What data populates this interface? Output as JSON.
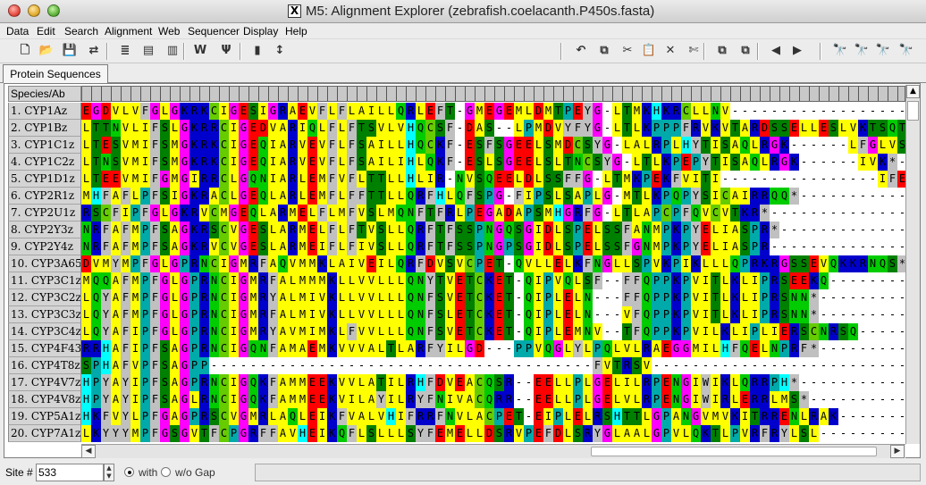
{
  "window": {
    "title": "M5: Alignment Explorer (zebrafish.coelacanth.P450s.fasta)"
  },
  "menu": [
    "Data",
    "Edit",
    "Search",
    "Alignment",
    "Web",
    "Sequencer",
    "Display",
    "Help"
  ],
  "toolbar": {
    "left": [
      {
        "name": "new-file-icon",
        "glyph": "🗋"
      },
      {
        "name": "open-folder-icon",
        "glyph": "📂"
      },
      {
        "name": "save-icon",
        "glyph": "💾"
      },
      {
        "name": "translate-icon",
        "glyph": "⇄"
      },
      {
        "name": "align-clustal-icon",
        "glyph": "≣"
      },
      {
        "name": "align-muscle-icon",
        "glyph": "▤"
      },
      {
        "name": "dna-toggle-icon",
        "glyph": "▥"
      },
      {
        "name": "clustalw-icon",
        "glyph": "W"
      },
      {
        "name": "muscle-arm-icon",
        "glyph": "Ψ"
      },
      {
        "name": "mark-site-icon",
        "glyph": "▮"
      },
      {
        "name": "cursor-icon",
        "glyph": "↕"
      }
    ],
    "right": [
      {
        "name": "undo-icon",
        "glyph": "↶"
      },
      {
        "name": "copy-icon",
        "glyph": "⧉"
      },
      {
        "name": "cut-icon",
        "glyph": "✂"
      },
      {
        "name": "paste-icon",
        "glyph": "📋"
      },
      {
        "name": "delete-icon",
        "glyph": "✕"
      },
      {
        "name": "delete-gap-columns-icon",
        "glyph": "✄"
      },
      {
        "name": "paste-block-icon",
        "glyph": "⧉"
      },
      {
        "name": "paste-block-alt-icon",
        "glyph": "⧉"
      },
      {
        "name": "prev-marked-icon",
        "glyph": "◀"
      },
      {
        "name": "next-marked-icon",
        "glyph": "▶"
      },
      {
        "name": "find-icon",
        "glyph": "🔭"
      },
      {
        "name": "find-previous-icon",
        "glyph": "🔭"
      },
      {
        "name": "find-next-icon",
        "glyph": "🔭"
      },
      {
        "name": "find-motif-icon",
        "glyph": "🔭"
      }
    ]
  },
  "tabs": [
    "Protein Sequences"
  ],
  "grid": {
    "header": "Species/Ab",
    "rows": [
      {
        "name": "1. CYP1Az",
        "seq": "EGDVLVFGLGKRKCIGESIGRAEVFLFLAILLQRLEFT-GMEGEMLDMTPEYG-LTMKHKRCLLNV---------------------TIKRGF----"
      },
      {
        "name": "2. CYP1Bz",
        "seq": "LTTNVLIFSLGKRRCIGEDVARIQLFLFTSVLVHQCSF-DAS--LPMDVYFYG-LTLKPPPFRVKVTARDSSELLESLVKTSQTETGV-"
      },
      {
        "name": "3. CYP1C1z",
        "seq": "LTESVMIFSMGKRKCIGEQIARVEVFLFSAILLHQCKF-ESFSGEELSMDCSYG-LALRPLHYTISAQLRGK------LFGLVSPA---"
      },
      {
        "name": "4. CYP1C2z",
        "seq": "LTNSVMIFSMGKRKCIGEQIARVEVFLFSAILIHLQKF-ESLSGEELSLTNCSYG-LTLKPEPYTISAQLRGK------IVK*----------"
      },
      {
        "name": "5. CYP1D1z",
        "seq": "LTEEVMIFGMGIRRCLGQNIARLEMFVFLTTLLHLIR-NVSQEELDLSSFFG-LTMKPEKFVITI----------------IFEN*----"
      },
      {
        "name": "6. CYP2R1z",
        "seq": "MHFAFLPFSIGKRACLGEQLARLEMFLFFTTLLQRFHLQFSPG-FIPSLSAPLG-MTLKPQPYSICAIRRQQ*------------------"
      },
      {
        "name": "7. CYP2U1z",
        "seq": "RSCFIPFGLGKRVCMGEQLARMELFLMFVSLMQNFTFRLPEGADAPSMHGRFG-LTLAPCPFQVCVTKR*--------------------"
      },
      {
        "name": "8. CYP2Y3z",
        "seq": "NRFAFMPFSAGKRSCVGESLARMELFLFTVSLLQRFTFSSPNGQSGIDLSPELSSFANMPKPYELIASPR*------------------"
      },
      {
        "name": "9. CYP2Y4z",
        "seq": "NRFAFMPFSAGKRVCVGESLARMEIFLFIVSLLQRFTFSSPNGPSGIDLSPELSSFGNMPKPYELIASPR-------------------"
      },
      {
        "name": "10. CYP3A65",
        "seq": "DVMYMPFGLGPRNCIGMRFAQVMMKLAIVEILQRFDVSVCPET-QVLLELKFNGLLSPVKPIKLLLQPRKRGSSEVQKKRNQS*-----"
      },
      {
        "name": "11. CYP3C1z",
        "seq": "MQQAFMPFGLGPRNCIGMRFALMMMKLLVVLLLQNYTVETCKET-QIPVQLSF--FFQPPKPVITLKLIPRSEEKQ-------------"
      },
      {
        "name": "12. CYP3C2z",
        "seq": "LQYAFMPFGLGPRNCIGMRYALMIVKLLVVLLLQNFSVETCKET-QIPLELN---FFQPPKPVITLKLIPRSNN*--------------"
      },
      {
        "name": "13. CYP3C3z",
        "seq": "LQYAFMPFGLGPRNCIGMRFALMIVKLLVVLLLQNFSLETCKET-QIPLELN---VFQPPKPVITLKLIPRSNN*--------------"
      },
      {
        "name": "14. CYP3C4z",
        "seq": "LQYAFIPFGLGPRNCIGMRYAVMIMKLFVVLLLQNFSVETCKET-QIPLEMNV--TFQPPKPVILKLIPLIERSCNRSQ----------"
      },
      {
        "name": "15. CYP4F43",
        "seq": "RRHAFIPFSAGPRNCIGQNFAMAEMKVVVALTLARFYILGD---PPVQGLYLPQLVLRAEGGMILHFQELNPRF*---------------"
      },
      {
        "name": "16. CYP4T8z",
        "seq": "SPHAFVPFSAGPP---------------------------------------FVTRSV-----------------------------------"
      },
      {
        "name": "17. CYP4V7z",
        "seq": "HPYAYIPFSAGPRNCIGQKFAMMEEKVVLATILRHFDVEACQSR--EELLPLGELILRPENGIWIKLQRRPH*-----------------"
      },
      {
        "name": "18. CYP4V8z",
        "seq": "HPYAYIPFSAGLRNCIGQKFAMMEEKVILAYILRYFNIVACQRR--EELLPLGELVLRPENGIWIRLERRLMS*----------------"
      },
      {
        "name": "19. CYP5A1z",
        "seq": "HKFVYLPFGAGPRSCVGMRLAQLEIKFVALVHIFRRFNVLACPET-EIPLELRSHTTLGPANGVMVKITRRENLRAK-------------"
      },
      {
        "name": "20. CYP7A1z",
        "seq": "LKYYYMPFGSGVTFCPGRFFAVHEIKQFLSLLLSYFEMELLDSRVPEFDLSRYGLAALGPVLQKTLPVRFRYLSL--------------"
      }
    ]
  },
  "status": {
    "site_label": "Site #",
    "site_value": "533",
    "with_label": "with",
    "without_label": "w/o Gap"
  },
  "colors": {
    "AVILM": "#ffff00",
    "FWY": "#c0c0c0",
    "G": "#ff00ff",
    "P": "#00aaaa",
    "ST": "#008000",
    "NQ": "#00cc00",
    "C": "#66cc00",
    "DE": "#ff0000",
    "KR": "#0000cc",
    "H": "#00ffff",
    "gap": "#ffffff"
  }
}
